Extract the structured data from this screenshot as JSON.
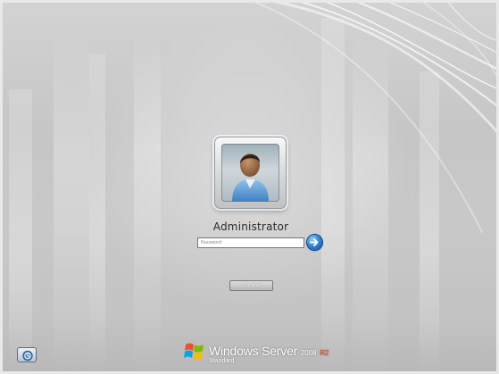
{
  "login": {
    "user_name": "Administrator",
    "password_placeholder": "Password",
    "password_value": "",
    "cancel_label": "Cancel"
  },
  "branding": {
    "product": "Windows Server",
    "version": "2008",
    "release": "R2",
    "edition": "Standard"
  },
  "icons": {
    "user_picture": "user-avatar-icon",
    "submit": "arrow-right-icon",
    "ease_of_access": "ease-of-access-icon",
    "logo": "windows-flag-icon"
  },
  "colors": {
    "background": "#c8c8c8",
    "submit_blue": "#2d8ae0",
    "release_accent": "#e0401a",
    "text": "#2b2b2b"
  }
}
